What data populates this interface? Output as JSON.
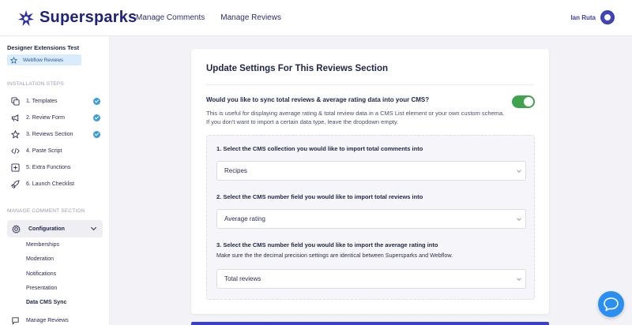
{
  "app": {
    "brand": "Supersparks",
    "brand_color": "#20237a",
    "accent": "#3b3fb4"
  },
  "topnav": {
    "items": [
      {
        "label": "Manage Comments"
      },
      {
        "label": "Manage Reviews"
      }
    ]
  },
  "user": {
    "name": "Ian Ruta",
    "avatar_icon": "user-circle-icon"
  },
  "sidebar": {
    "project": "Designer Extensions Test",
    "chip_label": "Webflow Reviews",
    "installation_heading": "INSTALLATION STEPS",
    "steps": [
      {
        "label": "1. Templates",
        "icon": "copy-icon",
        "done": true
      },
      {
        "label": "2. Review Form",
        "icon": "megaphone-icon",
        "done": true
      },
      {
        "label": "3. Reviews Section",
        "icon": "star-icon",
        "done": true
      },
      {
        "label": "4. Paste Script",
        "icon": "code-icon",
        "done": false
      },
      {
        "label": "5. Extra Functions",
        "icon": "plus-square-icon",
        "done": false
      },
      {
        "label": "6. Launch Checklist",
        "icon": "rocket-icon",
        "done": false
      }
    ],
    "manage_heading": "MANAGE COMMENT SECTION",
    "configuration_label": "Configuration",
    "sub_items": [
      {
        "label": "Memberships"
      },
      {
        "label": "Moderation"
      },
      {
        "label": "Notifications"
      },
      {
        "label": "Presentation"
      },
      {
        "label": "Data CMS Sync",
        "active": true
      }
    ],
    "manage_reviews_label": "Manage Reviews"
  },
  "main": {
    "title": "Update Settings For This Reviews Section",
    "sync_question": "Would you like to sync total reviews & average rating data into your CMS?",
    "sync_description": "This is useful for displaying average rating & total review data in a CMS List element or your own custom schema. If you don't want to import a certain data type, leave the dropdown empty.",
    "sync_enabled": true,
    "toggle_color": "#3fa34d",
    "fields": [
      {
        "label": "1. Select the CMS collection you would like to import total comments into",
        "value": "Recipes"
      },
      {
        "label": "2. Select the CMS number field you would like to import total reviews into",
        "value": "Average rating"
      },
      {
        "label": "3. Select the CMS number field you would like to import the average rating into",
        "note": "Make sure the the decimal precision settings are identical between Supersparks and Webflow.",
        "value": "Total reviews"
      }
    ]
  },
  "chat": {
    "icon": "chat-bubble-icon",
    "color": "#2a8ff0"
  }
}
